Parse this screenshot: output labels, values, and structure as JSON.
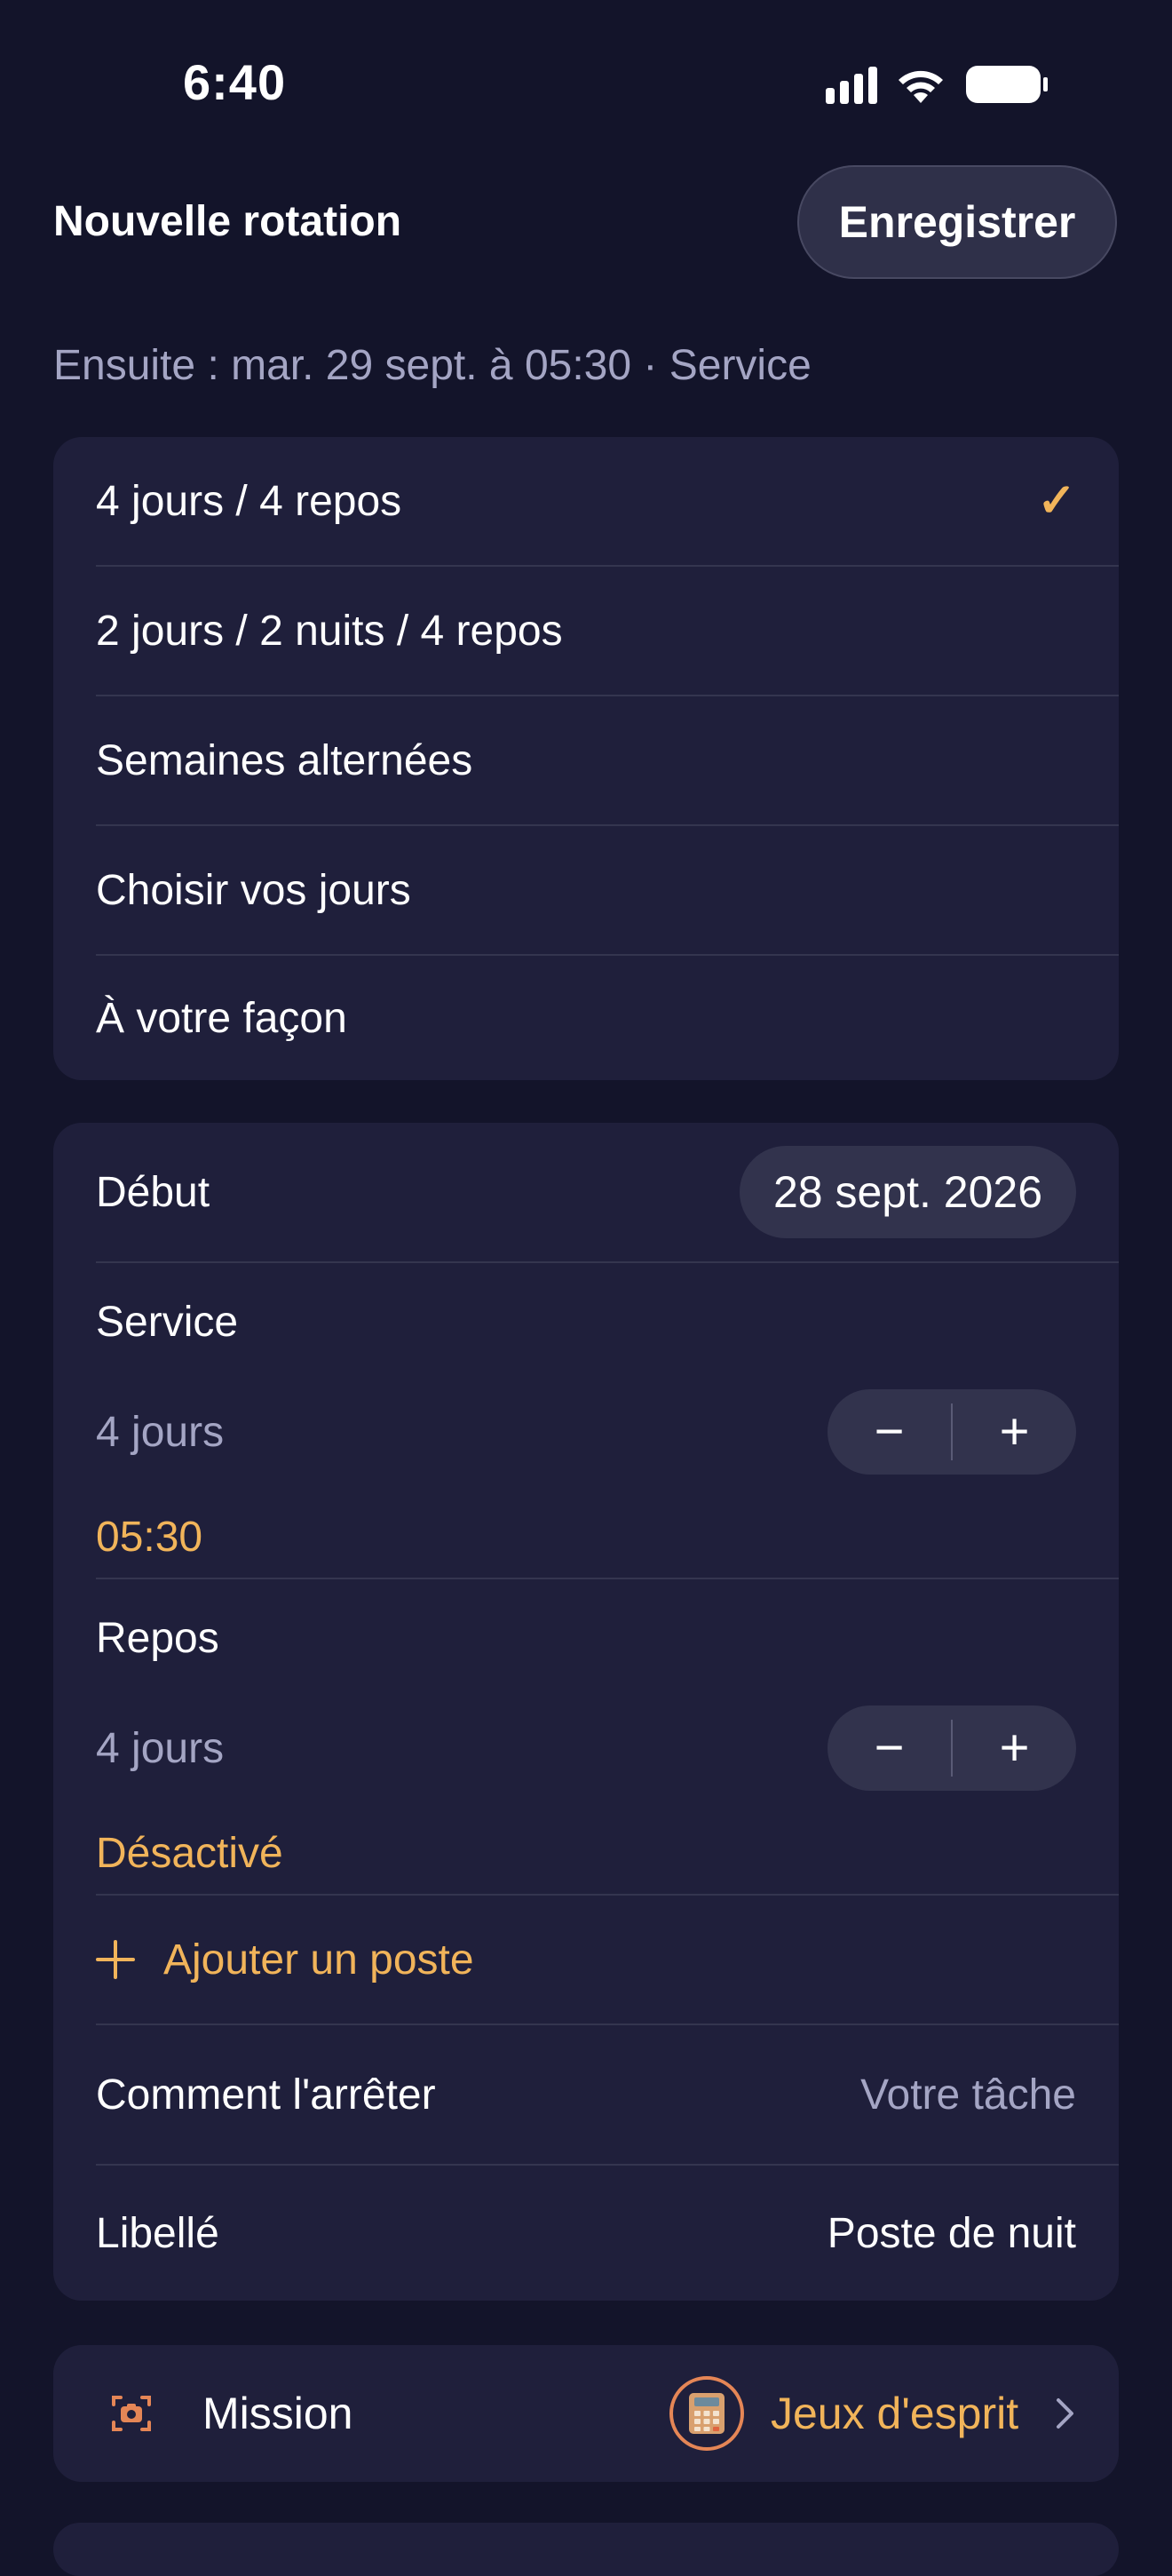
{
  "status_bar": {
    "time": "6:40"
  },
  "header": {
    "title": "Nouvelle rotation",
    "save_label": "Enregistrer"
  },
  "subtitle": "Ensuite : mar. 29 sept. à 05:30 · Service",
  "patterns": {
    "selected_index": 0,
    "items": [
      {
        "label": "4 jours / 4 repos"
      },
      {
        "label": "2 jours / 2 nuits / 4 repos"
      },
      {
        "label": "Semaines alternées"
      },
      {
        "label": "Choisir vos jours"
      },
      {
        "label": "À votre façon"
      }
    ]
  },
  "details": {
    "start": {
      "label": "Début",
      "value": "28 sept. 2026"
    },
    "service": {
      "label": "Service",
      "count": "4 jours",
      "time": "05:30"
    },
    "rest": {
      "label": "Repos",
      "count": "4 jours",
      "status": "Désactivé"
    },
    "add_post_label": "Ajouter un poste",
    "stop": {
      "label": "Comment l'arrêter",
      "value": "Votre tâche"
    },
    "name": {
      "label": "Libellé",
      "value": "Poste de nuit"
    },
    "stepper": {
      "minus": "−",
      "plus": "+"
    }
  },
  "mission": {
    "label": "Mission",
    "value": "Jeux d'esprit",
    "icon": "camera-scan-icon",
    "badge_icon": "calculator-icon"
  },
  "colors": {
    "background": "#13142a",
    "card": "#1f1f3b",
    "accent": "#f1b45a",
    "muted": "#a4a5c4",
    "mission_icon": "#e58656"
  }
}
